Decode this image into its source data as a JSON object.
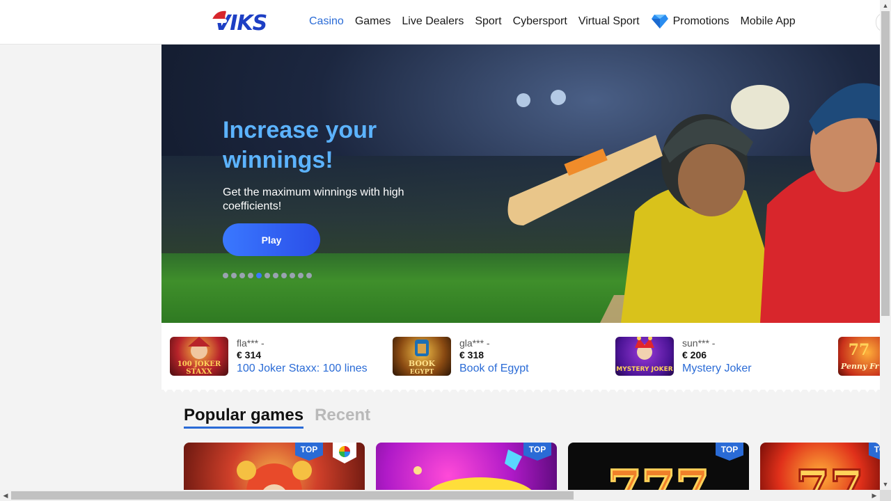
{
  "brand": {
    "logo_text": "VIKS"
  },
  "nav": {
    "items": [
      "Casino",
      "Games",
      "Live Dealers",
      "Sport",
      "Cybersport",
      "Virtual Sport"
    ],
    "promotions": "Promotions",
    "mobile_app": "Mobile App",
    "active": "Casino"
  },
  "hero": {
    "title": "Increase your winnings!",
    "subtitle": "Get the maximum winnings with high coefficients!",
    "play_label": "Play",
    "slides_total": 11,
    "active_slide": 5
  },
  "winners": [
    {
      "user": "fla*** -",
      "amount": "€ 314",
      "game": "100 Joker Staxx: 100 lines",
      "thumb_text": "100 JOKER STAXX"
    },
    {
      "user": "gla*** -",
      "amount": "€ 318",
      "game": "Book of Egypt",
      "thumb_text": "BOOK EGYPT"
    },
    {
      "user": "sun*** -",
      "amount": "€ 206",
      "game": "Mystery Joker",
      "thumb_text": "MYSTERY JOKER"
    },
    {
      "thumb_text": "Penny Fr"
    }
  ],
  "tabs": {
    "popular": "Popular games",
    "recent": "Recent"
  },
  "games": [
    {
      "badge": "TOP"
    },
    {
      "badge": "TOP"
    },
    {
      "badge": "TOP"
    },
    {
      "badge": "TOP"
    }
  ],
  "colors": {
    "accent": "#2a6bd6",
    "hero_title": "#5cb3ff",
    "play_button": "#3a78ff"
  }
}
